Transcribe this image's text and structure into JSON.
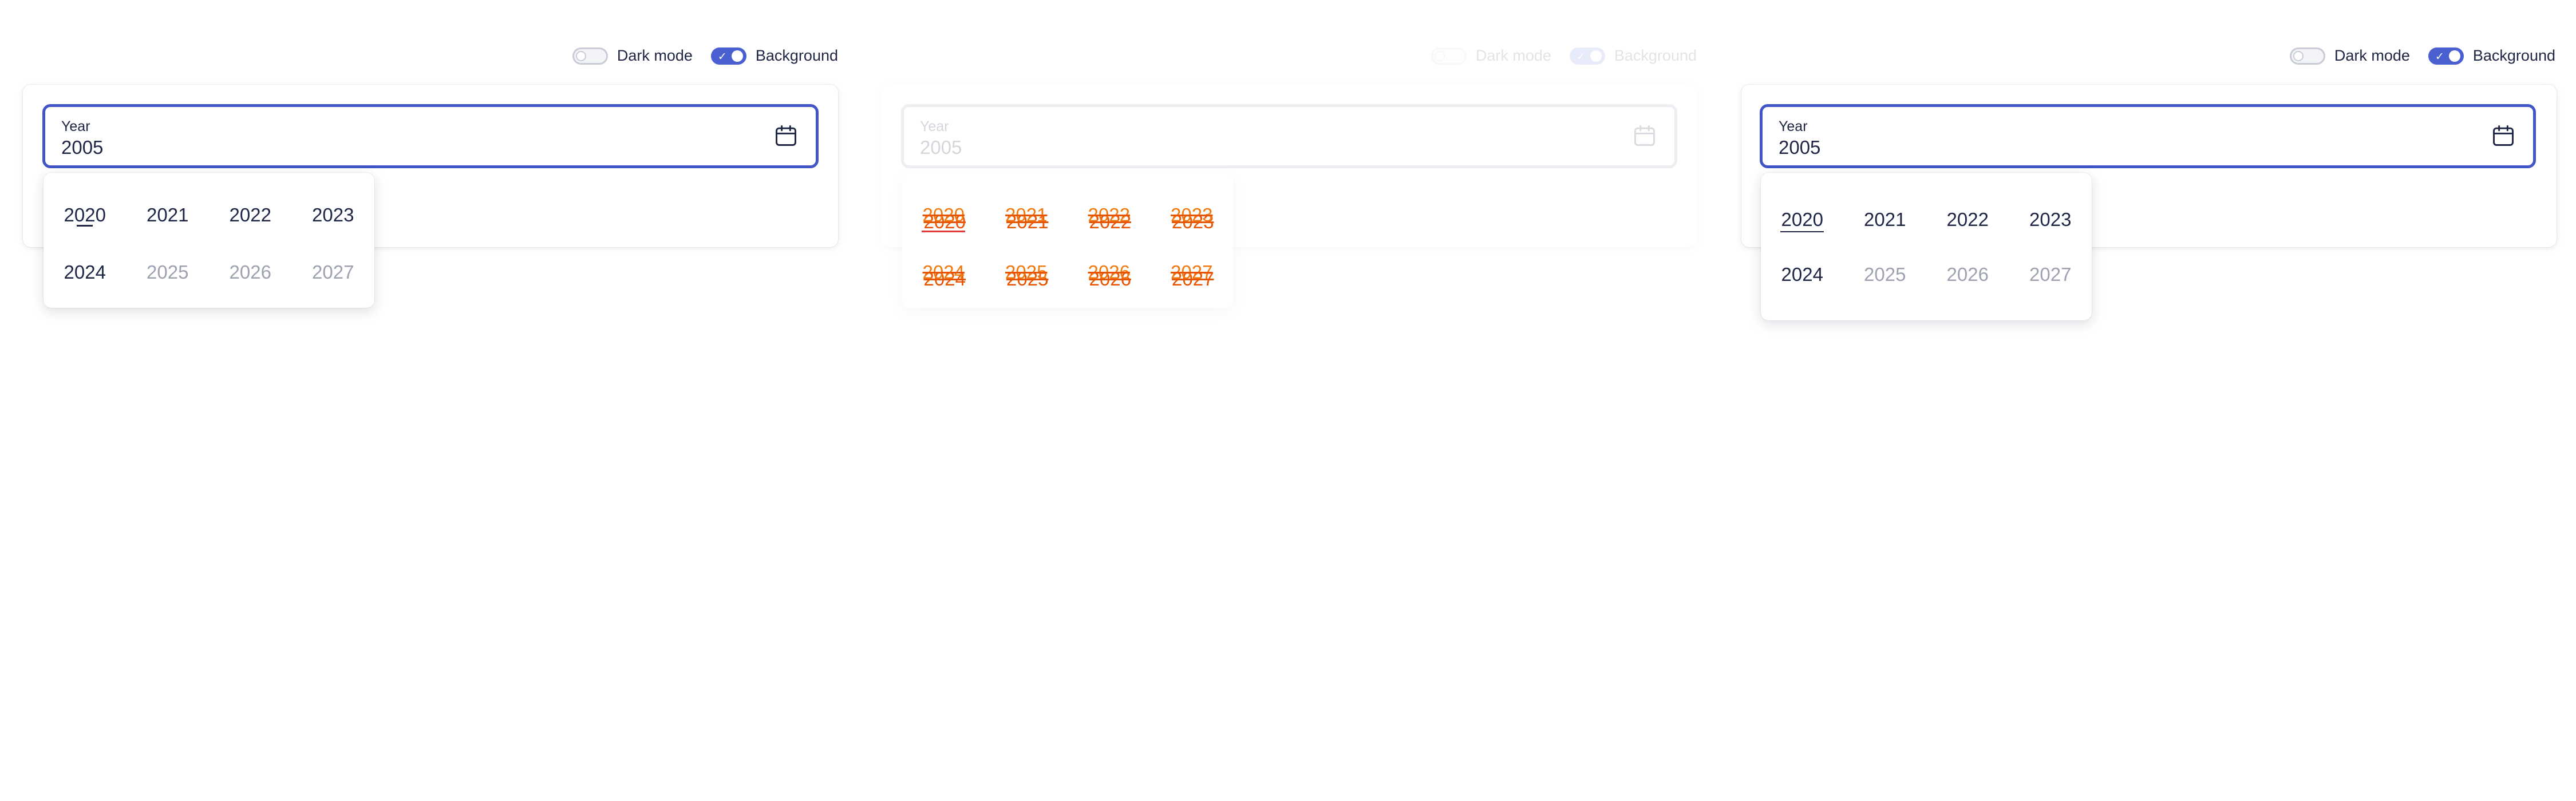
{
  "panels": {
    "left": {
      "toolbar": {
        "dark_mode_label": "Dark mode",
        "background_label": "Background",
        "dark_mode_on": false,
        "background_on": true
      },
      "field": {
        "label": "Year",
        "value": "2005"
      },
      "years": [
        "2020",
        "2021",
        "2022",
        "2023",
        "2024",
        "2025",
        "2026",
        "2027"
      ]
    },
    "mid": {
      "toolbar": {
        "dark_mode_label": "Dark mode",
        "background_label": "Background",
        "dark_mode_on": false,
        "background_on": true
      },
      "field": {
        "label": "Year",
        "value": "2005"
      },
      "years": [
        "2020",
        "2021",
        "2022",
        "2023",
        "2024",
        "2025",
        "2026",
        "2027"
      ]
    },
    "right": {
      "toolbar": {
        "dark_mode_label": "Dark mode",
        "background_label": "Background",
        "dark_mode_on": false,
        "background_on": true
      },
      "field": {
        "label": "Year",
        "value": "2005"
      },
      "years": [
        "2020",
        "2021",
        "2022",
        "2023",
        "2024",
        "2025",
        "2026",
        "2027"
      ]
    }
  },
  "icons": {
    "calendar": "calendar-icon",
    "check": "check-icon"
  },
  "colors": {
    "accent": "#4255c6",
    "text": "#1f2544",
    "disabled": "#9ea2b0",
    "diff_orange": "#f07a10",
    "diff_red": "#e83a3a"
  }
}
